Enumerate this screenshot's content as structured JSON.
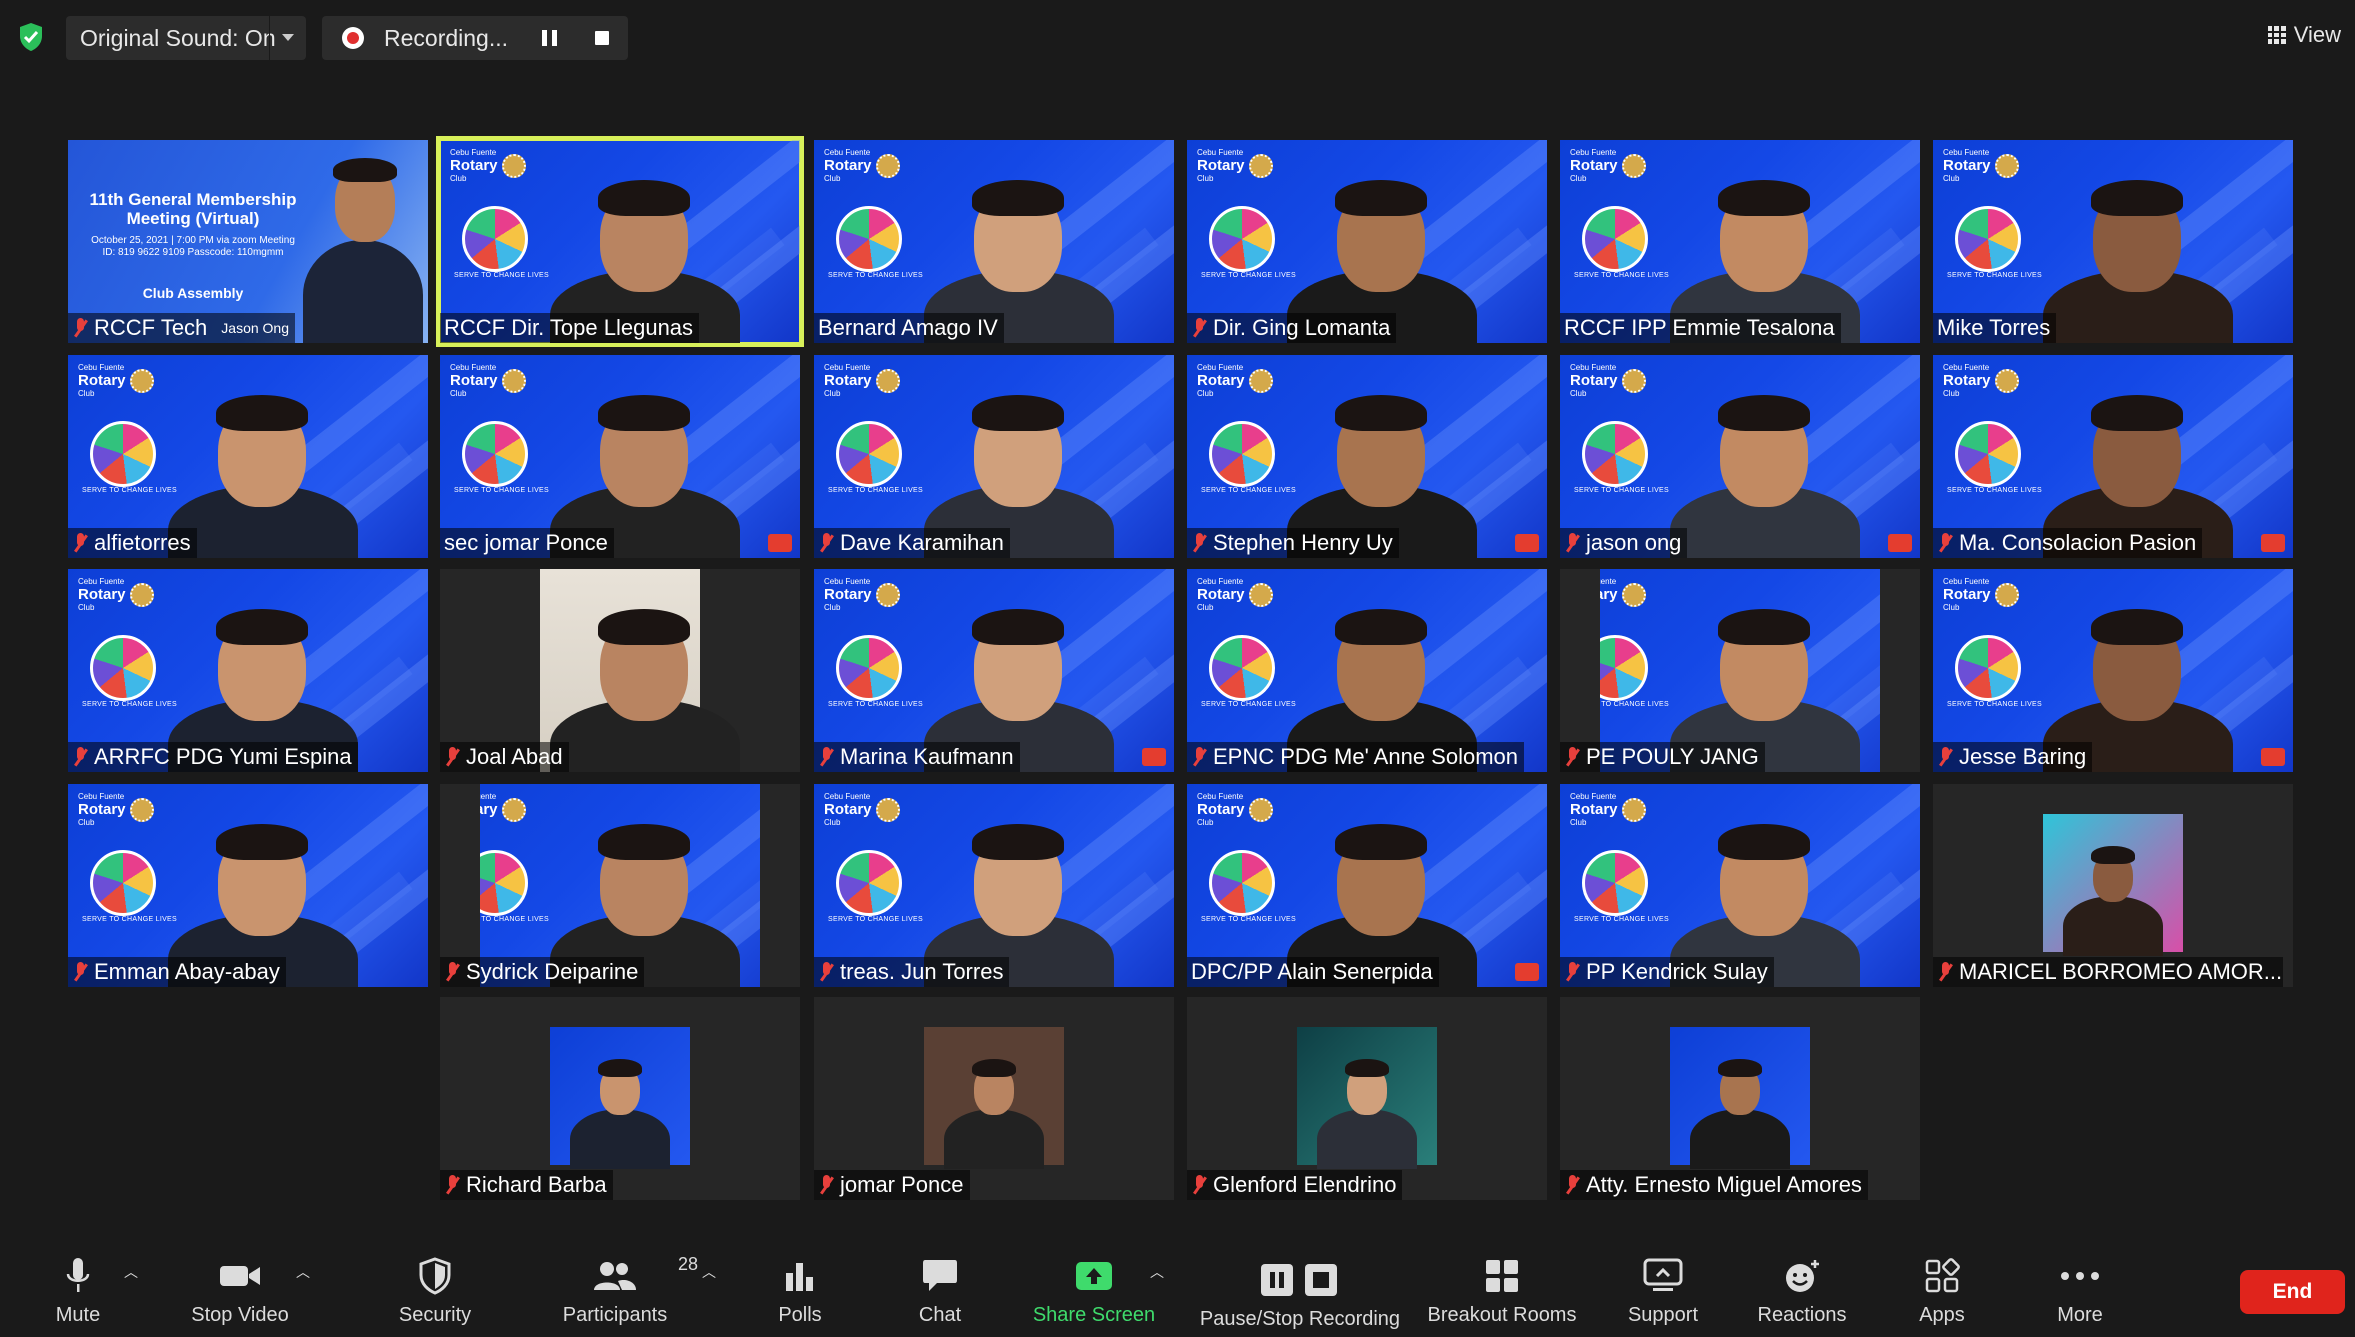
{
  "top_bar": {
    "sound_label": "Original Sound: On",
    "recording_label": "Recording...",
    "view_label": "View"
  },
  "slide": {
    "line1": "11th General Membership Meeting (Virtual)",
    "line2": "October 25, 2021 | 7:00 PM via zoom Meeting ID: 819 9622 9109 Passcode: 110mgmm",
    "line3": "Club Assembly"
  },
  "participants": [
    {
      "name": "RCCF Tech",
      "suffix": "Jason Ong"
    },
    {
      "name": "RCCF Dir. Tope Llegunas"
    },
    {
      "name": "Bernard Amago IV"
    },
    {
      "name": "Dir. Ging Lomanta"
    },
    {
      "name": "RCCF IPP Emmie Tesalona"
    },
    {
      "name": "Mike Torres"
    },
    {
      "name": "alfietorres"
    },
    {
      "name": "sec jomar Ponce"
    },
    {
      "name": "Dave Karamihan"
    },
    {
      "name": "Stephen Henry Uy"
    },
    {
      "name": "jason ong"
    },
    {
      "name": "Ma. Consolacion Pasion"
    },
    {
      "name": "ARRFC PDG Yumi Espina"
    },
    {
      "name": "Joal Abad"
    },
    {
      "name": "Marina Kaufmann"
    },
    {
      "name": "EPNC PDG Me' Anne Solomon"
    },
    {
      "name": "PE   POULY JANG"
    },
    {
      "name": "Jesse Baring"
    },
    {
      "name": "Emman Abay-abay"
    },
    {
      "name": "Sydrick Deiparine"
    },
    {
      "name": "treas. Jun Torres"
    },
    {
      "name": "DPC/PP Alain Senerpida"
    },
    {
      "name": "PP Kendrick Sulay"
    },
    {
      "name": "MARICEL BORROMEO AMOR..."
    },
    {
      "name": "Richard Barba"
    },
    {
      "name": "jomar Ponce"
    },
    {
      "name": "Glenford Elendrino"
    },
    {
      "name": "Atty. Ernesto Miguel Amores"
    }
  ],
  "background_text": {
    "club": "Cebu Fuente",
    "rotary": "Rotary",
    "club2": "Club",
    "tagline": "SERVE TO CHANGE LIVES"
  },
  "toolbar": {
    "mute": "Mute",
    "stop_video": "Stop Video",
    "security": "Security",
    "participants": "Participants",
    "participant_count": "28",
    "polls": "Polls",
    "chat": "Chat",
    "share_screen": "Share Screen",
    "pause_stop_recording": "Pause/Stop Recording",
    "breakout_rooms": "Breakout Rooms",
    "support": "Support",
    "reactions": "Reactions",
    "apps": "Apps",
    "more": "More",
    "end": "End"
  },
  "colors": {
    "background": "#1a1a1a",
    "active_speaker": "#d8f05a",
    "share_green": "#3fdb6c",
    "end_red": "#e0241c",
    "muted_red": "#e8403c",
    "virtual_bg_blue": "#1448e6"
  },
  "icons": [
    "shield-icon",
    "record-icon",
    "pause-icon",
    "stop-icon",
    "grid-view-icon",
    "microphone-icon",
    "video-camera-icon",
    "security-shield-icon",
    "participants-icon",
    "polls-icon",
    "chat-icon",
    "share-screen-icon",
    "pause-stop-recording-icon",
    "breakout-rooms-icon",
    "support-icon",
    "reactions-icon",
    "apps-icon",
    "more-icon",
    "muted-mic-icon",
    "heart-reaction-icon"
  ]
}
